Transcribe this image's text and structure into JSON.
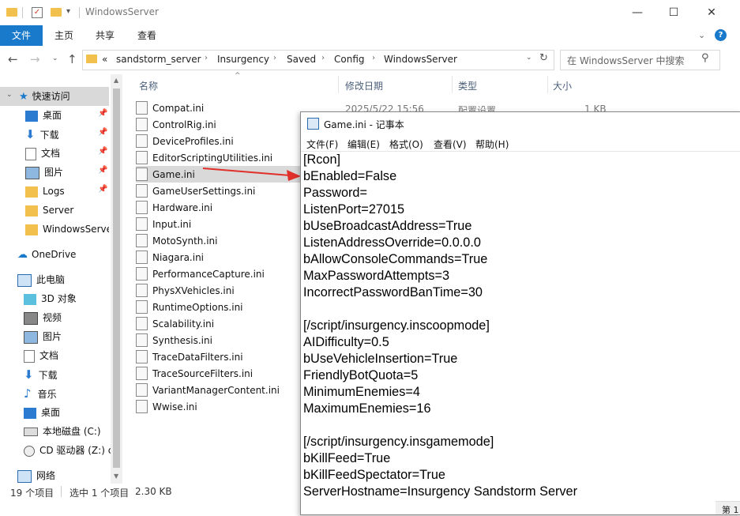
{
  "window": {
    "title": "WindowsServer"
  },
  "ribbon": {
    "tabs": [
      "文件",
      "主页",
      "共享",
      "查看"
    ]
  },
  "address": {
    "crumbs": [
      "«",
      "sandstorm_server",
      "Insurgency",
      "Saved",
      "Config",
      "WindowsServer"
    ],
    "search_placeholder": "在 WindowsServer 中搜索"
  },
  "columns": {
    "name": "名称",
    "date": "修改日期",
    "type": "类型",
    "size": "大小"
  },
  "first_row_meta": {
    "date": "2025/5/22 15:56",
    "type": "配置设置",
    "size": "1 KB"
  },
  "sidebar": {
    "quick_access": "快速访问",
    "quick_items": [
      "桌面",
      "下载",
      "文档",
      "图片",
      "Logs",
      "Server",
      "WindowsServe"
    ],
    "onedrive": "OneDrive",
    "this_pc": "此电脑",
    "pc_items": [
      "3D 对象",
      "视频",
      "图片",
      "文档",
      "下载",
      "音乐",
      "桌面",
      "本地磁盘 (C:)",
      "CD 驱动器 (Z:) c"
    ],
    "network": "网络"
  },
  "files": [
    "Compat.ini",
    "ControlRig.ini",
    "DeviceProfiles.ini",
    "EditorScriptingUtilities.ini",
    "Game.ini",
    "GameUserSettings.ini",
    "Hardware.ini",
    "Input.ini",
    "MotoSynth.ini",
    "Niagara.ini",
    "PerformanceCapture.ini",
    "PhysXVehicles.ini",
    "RuntimeOptions.ini",
    "Scalability.ini",
    "Synthesis.ini",
    "TraceDataFilters.ini",
    "TraceSourceFilters.ini",
    "VariantManagerContent.ini",
    "Wwise.ini"
  ],
  "selected_file": "Game.ini",
  "status": {
    "count": "19 个项目",
    "selected": "选中 1 个项目",
    "size": "2.30 KB"
  },
  "notepad": {
    "title": "Game.ini - 记事本",
    "menu": [
      "文件(F)",
      "编辑(E)",
      "格式(O)",
      "查看(V)",
      "帮助(H)"
    ],
    "lines": [
      "[Rcon]",
      "bEnabled=False",
      "Password=",
      "ListenPort=27015",
      "bUseBroadcastAddress=True",
      "ListenAddressOverride=0.0.0.0",
      "bAllowConsoleCommands=True",
      "MaxPasswordAttempts=3",
      "IncorrectPasswordBanTime=30",
      "",
      "[/script/insurgency.inscoopmode]",
      "AIDifficulty=0.5",
      "bUseVehicleInsertion=True",
      "FriendlyBotQuota=5",
      "MinimumEnemies=4",
      "MaximumEnemies=16",
      "",
      "[/script/insurgency.insgamemode]",
      "bKillFeed=True",
      "bKillFeedSpectator=True",
      "ServerHostname=Insurgency Sandstorm Server"
    ],
    "status_fragment": "第 1"
  },
  "colors": {
    "accent": "#1979ca",
    "selected_bg": "#cce8ff",
    "arrow": "#e0302a"
  }
}
